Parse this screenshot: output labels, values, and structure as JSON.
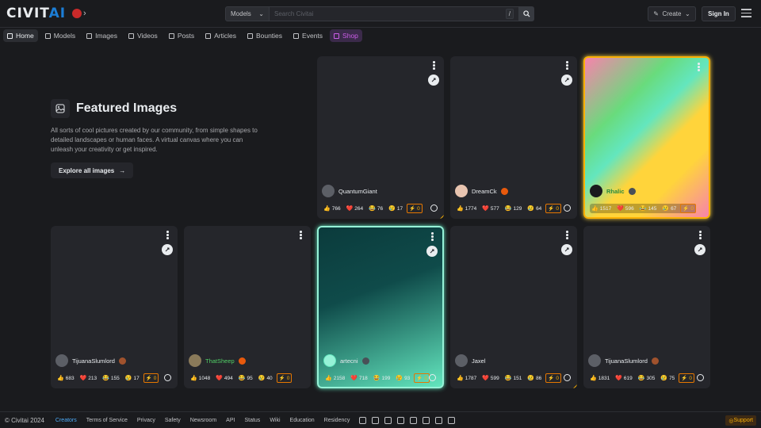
{
  "brand": {
    "logo": "CIVIT",
    "logo_ai": "AI"
  },
  "search": {
    "scope": "Models",
    "placeholder": "Search Civitai",
    "shortcut": "/"
  },
  "header": {
    "create_label": "Create",
    "signin_label": "Sign In"
  },
  "nav": [
    {
      "label": "Home",
      "active": true
    },
    {
      "label": "Models"
    },
    {
      "label": "Images"
    },
    {
      "label": "Videos"
    },
    {
      "label": "Posts"
    },
    {
      "label": "Articles"
    },
    {
      "label": "Bounties"
    },
    {
      "label": "Events"
    },
    {
      "label": "Shop",
      "shop": true
    }
  ],
  "hero": {
    "title": "Featured Images",
    "description": "All sorts of cool pictures created by our community, from simple shapes to detailed landscapes or human faces. A virtual canvas where you can unleash your creativity or get inspired.",
    "button": "Explore all images"
  },
  "cards": [
    {
      "user": "QuantumGiant",
      "likes": "766",
      "hearts": "264",
      "laughs": "76",
      "cries": "17",
      "buzz": "0",
      "style": "plain",
      "remix": true,
      "corner": true
    },
    {
      "user": "DreamCk",
      "likes": "1774",
      "hearts": "577",
      "laughs": "129",
      "cries": "64",
      "buzz": "0",
      "style": "plain",
      "remix": true
    },
    {
      "user": "Rhalic",
      "likes": "1517",
      "hearts": "596",
      "laughs": "145",
      "cries": "67",
      "buzz": "0",
      "style": "rainbow",
      "remix": false
    },
    {
      "user": "TijuanaSlumlord",
      "likes": "683",
      "hearts": "213",
      "laughs": "155",
      "cries": "17",
      "buzz": "0",
      "style": "plain",
      "remix": true
    },
    {
      "user": "ThatSheep",
      "likes": "1048",
      "hearts": "494",
      "laughs": "95",
      "cries": "40",
      "buzz": "0",
      "style": "plain",
      "remix": false,
      "green_name": true
    },
    {
      "user": "artecni",
      "likes": "2158",
      "hearts": "718",
      "laughs": "199",
      "cries": "93",
      "buzz": "0",
      "style": "teal",
      "remix": true
    },
    {
      "user": "Jaxel",
      "likes": "1787",
      "hearts": "599",
      "laughs": "151",
      "cries": "86",
      "buzz": "0",
      "style": "plain",
      "remix": true,
      "corner": true
    },
    {
      "user": "TijuanaSlumlord",
      "likes": "1831",
      "hearts": "619",
      "laughs": "305",
      "cries": "75",
      "buzz": "0",
      "style": "plain",
      "remix": true
    }
  ],
  "footer": {
    "copyright": "© Civitai 2024",
    "links": [
      "Creators",
      "Terms of Service",
      "Privacy",
      "Safety",
      "Newsroom",
      "API",
      "Status",
      "Wiki",
      "Education",
      "Residency"
    ],
    "social_icons": [
      "discord-icon",
      "x-icon",
      "instagram-icon",
      "youtube-icon",
      "tiktok-icon",
      "reddit-icon",
      "github-icon",
      "chat-icon"
    ],
    "support": "Support"
  }
}
